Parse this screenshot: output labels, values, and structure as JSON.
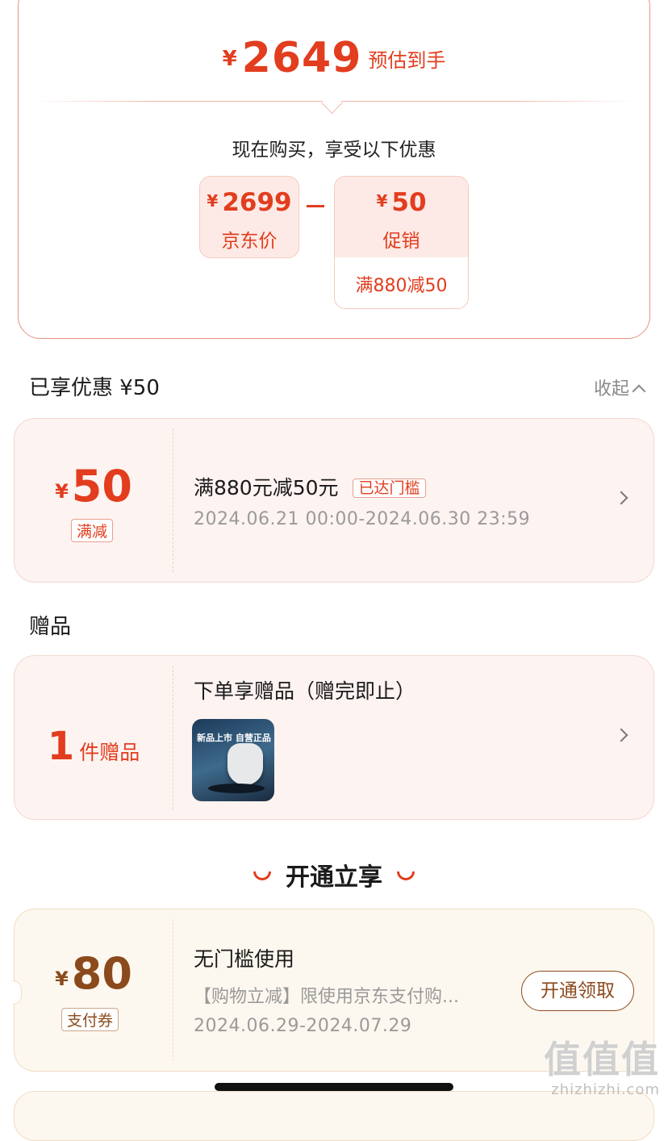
{
  "summary": {
    "yen": "¥",
    "price": "2649",
    "price_label": "预估到手",
    "subtitle": "现在购买，享受以下优惠",
    "jd_price": {
      "yen": "¥",
      "value": "2699",
      "label": "京东价"
    },
    "promo": {
      "yen": "¥",
      "value": "50",
      "label": "促销",
      "note": "满880减50"
    }
  },
  "enjoyed": {
    "title": "已享优惠 ¥50",
    "collapse_label": "收起"
  },
  "coupon": {
    "yen": "¥",
    "amount": "50",
    "tag": "满减",
    "title": "满880元减50元",
    "badge": "已达门槛",
    "date": "2024.06.21 00:00-2024.06.30 23:59"
  },
  "gift_section": {
    "title": "赠品",
    "count": "1",
    "count_unit": "件赠品",
    "card_title": "下单享赠品（赠完即止）",
    "image_text": "新品上市 自营正品"
  },
  "open_section": {
    "title": "开通立享"
  },
  "pay_coupon": {
    "yen": "¥",
    "amount": "80",
    "tag": "支付券",
    "title": "无门槛使用",
    "desc": "【购物立减】限使用京东支付购...",
    "date": "2024.06.29-2024.07.29",
    "button": "开通领取"
  },
  "watermark": {
    "logo": "值值值",
    "url": "zhizhizhi.com"
  },
  "colors": {
    "accent": "#e23d1e",
    "pay_accent": "#8b4a1c"
  }
}
